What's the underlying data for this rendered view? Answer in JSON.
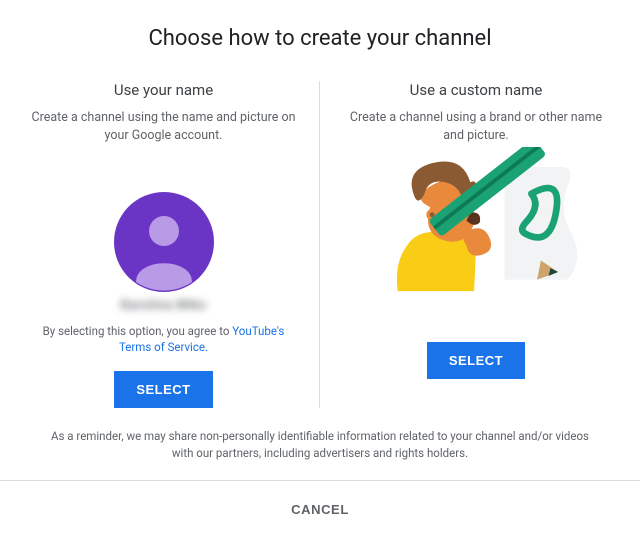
{
  "dialog": {
    "title": "Choose how to create your channel",
    "disclaimer": "As a reminder, we may share non-personally identifiable information related to your channel and/or videos with our partners, including advertisers and rights holders.",
    "cancel_label": "CANCEL"
  },
  "left": {
    "title": "Use your name",
    "description": "Create a channel using the name and picture on your Google account.",
    "username_placeholder": "Karolina Miks",
    "tos_prefix": "By selecting this option, you agree to",
    "tos_link_text": "YouTube's Terms of Service.",
    "select_label": "SELECT"
  },
  "right": {
    "title": "Use a custom name",
    "description": "Create a channel using a brand or other name and picture.",
    "select_label": "SELECT"
  }
}
